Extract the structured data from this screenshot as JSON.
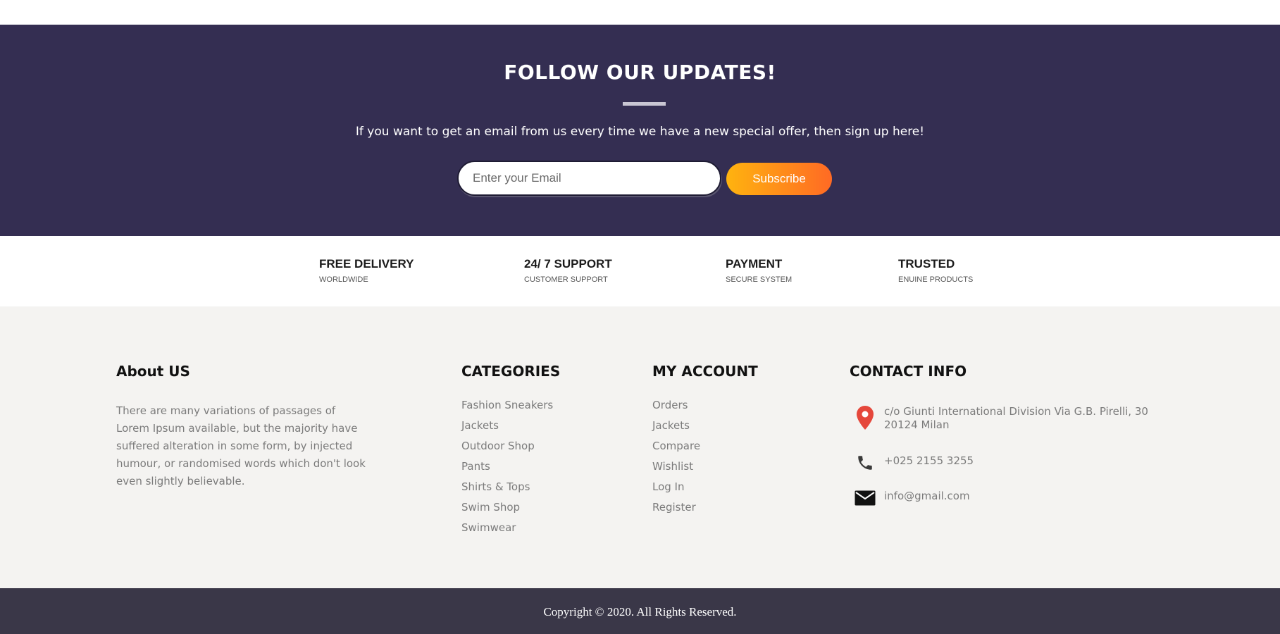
{
  "newsletter": {
    "title": "FOLLOW OUR UPDATES!",
    "text": "If you want to get an email from us every time we have a new special offer, then sign up here!",
    "email_placeholder": "Enter your Email",
    "subscribe_label": "Subscribe",
    "colors": {
      "background": "#342e52",
      "button_start": "#ffb30f",
      "button_end": "#ff6a24"
    }
  },
  "features": [
    {
      "title": "FREE DELIVERY",
      "subtitle": "WORLDWIDE"
    },
    {
      "title": "24/ 7 SUPPORT",
      "subtitle": "CUSTOMER SUPPORT"
    },
    {
      "title": "PAYMENT",
      "subtitle": "SECURE SYSTEM"
    },
    {
      "title": "TRUSTED",
      "subtitle": "ENUINE PRODUCTS"
    }
  ],
  "footer": {
    "about": {
      "title": "About US",
      "text": "There are many variations of passages of Lorem Ipsum available, but the majority have suffered alteration in some form, by injected humour, or randomised words which don't look even slightly believable."
    },
    "categories": {
      "title": "CATEGORIES",
      "items": [
        "Fashion Sneakers",
        "Jackets",
        "Outdoor Shop",
        "Pants",
        "Shirts & Tops",
        "Swim Shop",
        "Swimwear"
      ]
    },
    "account": {
      "title": "MY ACCOUNT",
      "items": [
        "Orders",
        "Jackets",
        "Compare",
        "Wishlist",
        "Log In",
        "Register"
      ]
    },
    "contact": {
      "title": "CONTACT INFO",
      "address_line1": "c/o Giunti International Division Via G.B. Pirelli, 30",
      "address_line2": "20124 Milan",
      "phone": "+025 2155 3255",
      "email": "info@gmail.com",
      "icons": [
        "map-pin-icon",
        "phone-icon",
        "envelope-icon"
      ]
    }
  },
  "copyright": "Copyright © 2020. All Rights Reserved."
}
